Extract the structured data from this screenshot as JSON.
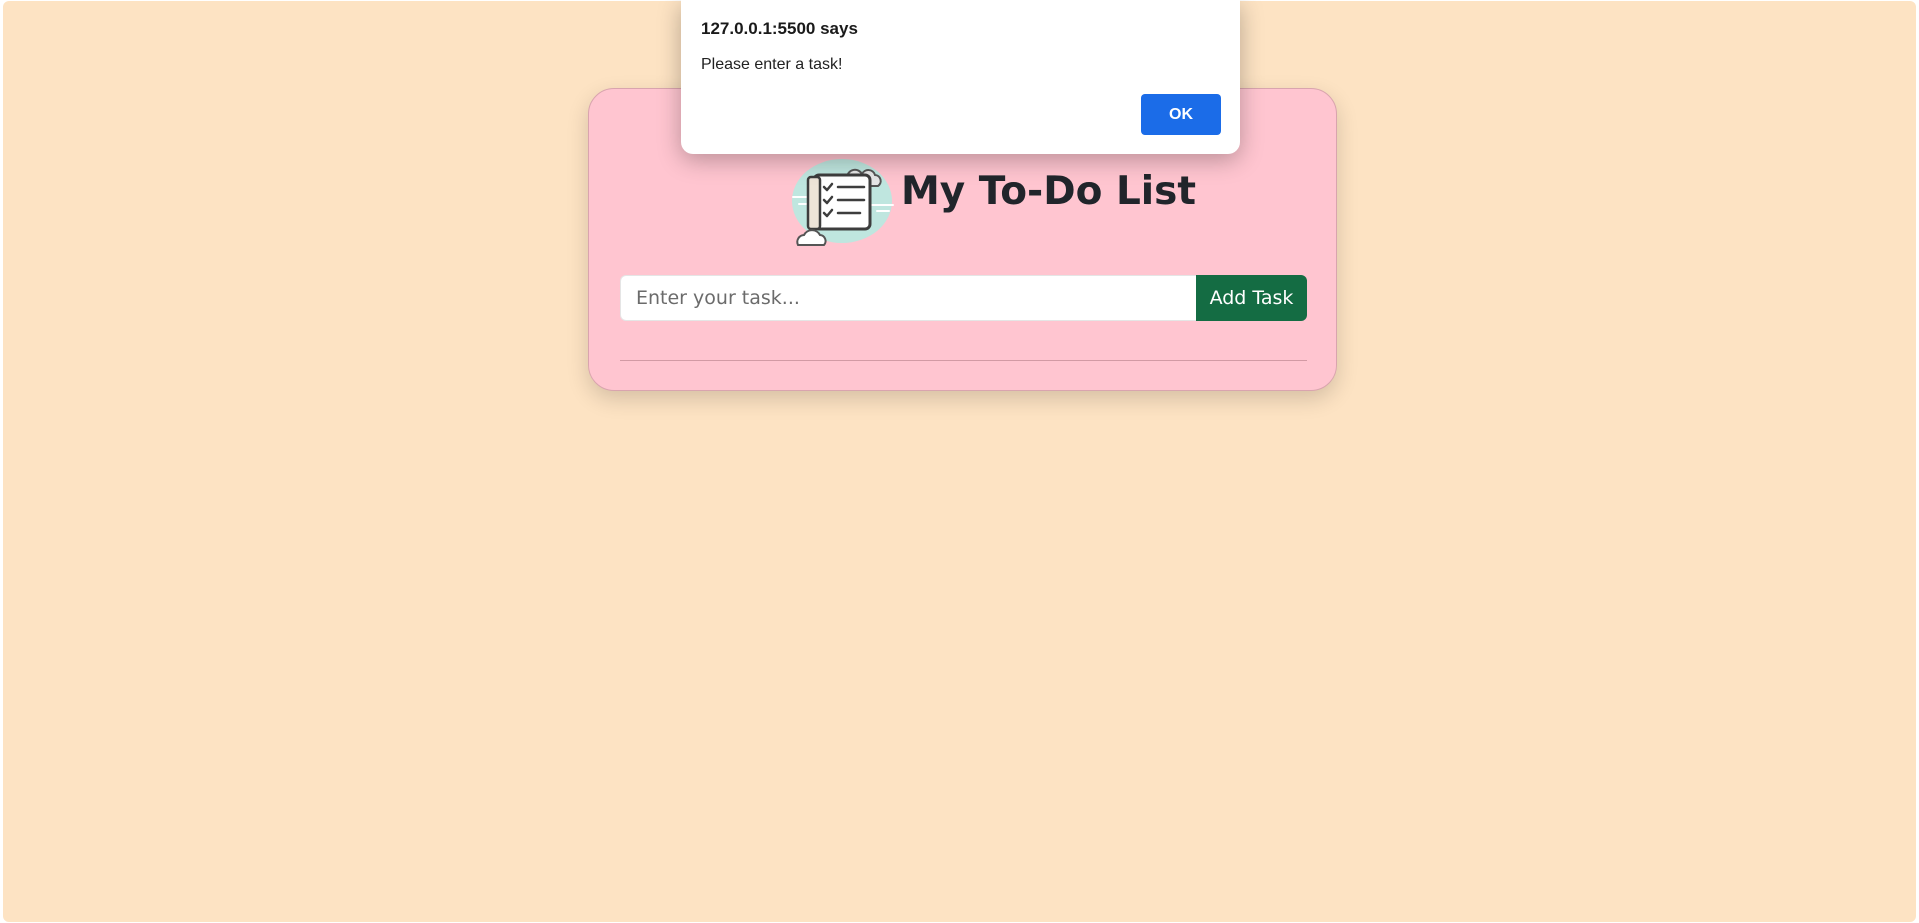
{
  "alert": {
    "title": "127.0.0.1:5500 says",
    "message": "Please enter a task!",
    "ok_label": "OK",
    "button_color": "#1b6ce8"
  },
  "todo": {
    "title": "My To-Do List",
    "logo_icon": "checklist-icon",
    "input_value": "",
    "input_placeholder": "Enter your task...",
    "add_label": "Add Task",
    "add_button_color": "#146c43",
    "tasks": []
  },
  "colors": {
    "page_background": "#fde3c3",
    "card_background": "#ffc5d0"
  }
}
